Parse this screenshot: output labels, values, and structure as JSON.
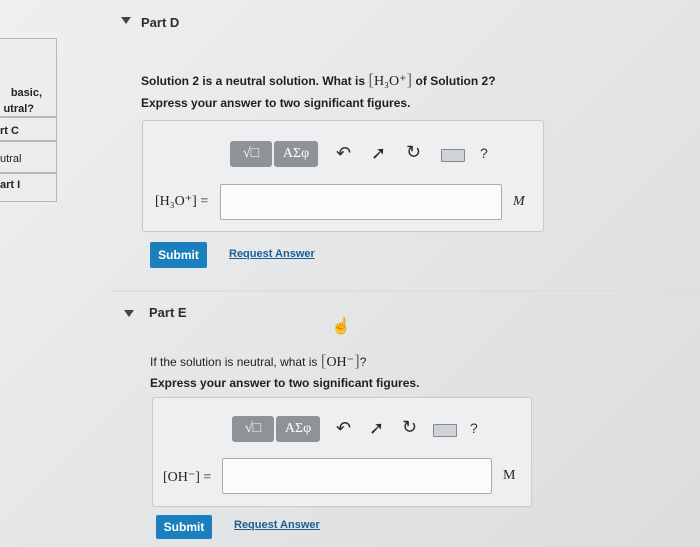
{
  "left_table": {
    "cells": [
      {
        "line1": "basic,",
        "line2": "utral?"
      },
      {
        "line1": "rt C"
      },
      {
        "line1": "utral"
      },
      {
        "line1": "art I"
      }
    ]
  },
  "part_d": {
    "title": "Part D",
    "question_prefix": "Solution 2 is a neutral solution. What is",
    "question_symbol": "H₃O⁺",
    "question_suffix": "of Solution 2?",
    "instruction": "Express your answer to two significant figures.",
    "toolbar": {
      "template_button": "√□",
      "greek_button": "ΑΣφ",
      "help": "?"
    },
    "answer_label": "[H₃O⁺] =",
    "answer_value": "",
    "unit": "M",
    "submit_label": "Submit",
    "request_label": "Request Answer"
  },
  "part_e": {
    "title": "Part E",
    "question_prefix": "If the solution is neutral, what is",
    "question_symbol": "OH⁻",
    "question_suffix": "?",
    "instruction": "Express your answer to two significant figures.",
    "toolbar": {
      "template_button": "√□",
      "greek_button": "ΑΣφ",
      "help": "?"
    },
    "answer_label": "[OH⁻] =",
    "answer_value": "",
    "unit": "M",
    "submit_label": "Submit",
    "request_label": "Request Answer"
  }
}
